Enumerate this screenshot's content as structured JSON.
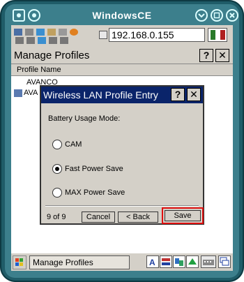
{
  "window": {
    "title": "WindowsCE"
  },
  "toolbar": {
    "ip_address": "192.168.0.155"
  },
  "manage_profiles": {
    "title": "Manage Profiles",
    "help_label": "?",
    "close_label": "✕",
    "column_header": "Profile Name",
    "rows": [
      "AVANCO",
      "AVA"
    ]
  },
  "dialog": {
    "title": "Wireless LAN Profile Entry",
    "help_label": "?",
    "close_label": "✕",
    "section_label": "Battery Usage Mode:",
    "options": [
      {
        "label": "CAM",
        "selected": false
      },
      {
        "label": "Fast Power Save",
        "selected": true
      },
      {
        "label": "MAX Power Save",
        "selected": false
      }
    ],
    "page_indicator": "9 of 9",
    "cancel_label": "Cancel",
    "back_label": "< Back",
    "save_label": "Save"
  },
  "taskbar": {
    "active_task": "Manage Profiles",
    "tray_icons": [
      "A-input-icon",
      "bfon-vnc-icon",
      "network-icon",
      "keyboard-icon",
      "task-switch-icon"
    ]
  },
  "colors": {
    "dialog_title_bg": "#0a246a",
    "frame": "#1f5c68",
    "highlight": "#e01010"
  }
}
